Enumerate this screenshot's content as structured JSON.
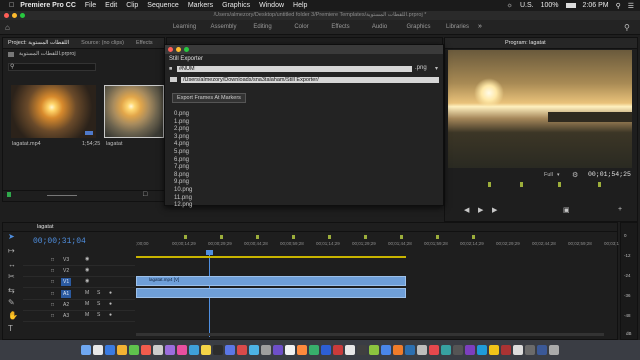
{
  "menubar": {
    "app": "Premiere Pro CC",
    "items": [
      "File",
      "Edit",
      "Clip",
      "Sequence",
      "Markers",
      "Graphics",
      "Window",
      "Help"
    ],
    "locale": "U.S.",
    "battery": "100%",
    "time": "2:06 PM"
  },
  "titlebar": {
    "path": "/Users/almezory/Desktop/untitled folder 3/Premiere Templates/اللقطات المستوية.prproj *"
  },
  "workspaces": [
    "Learning",
    "Assembly",
    "Editing",
    "Color",
    "Effects",
    "Audio",
    "Graphics",
    "Libraries"
  ],
  "project": {
    "tabs": [
      "Project: اللقطات المستوية",
      "Source: (no clips)",
      "Effects"
    ],
    "bin": "اللقطات المستوية.prproj",
    "items": [
      {
        "name": "lagatat.mp4",
        "duration": "1;54;25"
      },
      {
        "name": "lagatat",
        "duration": ""
      }
    ]
  },
  "program": {
    "tab": "Program: lagatat",
    "fit": "Full",
    "timecode": "00;01;54;25"
  },
  "dialog": {
    "title": "Still Exporter",
    "name_pattern": "#NUM",
    "format": ".png",
    "folder": "/Users/almezory/Downloads/sna3talaham/Still Exporter/",
    "export_button": "Export Frames At Markers",
    "files": [
      "0.png",
      "1.png",
      "2.png",
      "3.png",
      "4.png",
      "5.png",
      "6.png",
      "7.png",
      "8.png",
      "9.png",
      "10.png",
      "11.png",
      "12.png"
    ]
  },
  "timeline": {
    "sequence": "lagatat",
    "timecode": "00;00;31;04",
    "ruler": [
      ";00;00",
      "00;00;14;29",
      "00;00;29;29",
      "00;00;44;28",
      "00;00;59;28",
      "00;01;14;29",
      "00;01;29;29",
      "00;01;44;28",
      "00;01;59;28",
      "00;02;14;29",
      "00;02;29;29",
      "00;02;44;28",
      "00;02;59;28",
      "00;03;1"
    ],
    "tracks": [
      "V3",
      "V2",
      "V1",
      "A1",
      "A2",
      "A3"
    ],
    "track_buttons": [
      "M",
      "S"
    ],
    "clip_label": "lagatat.mp4 [V]"
  },
  "meter": {
    "scale": [
      "0",
      "-12",
      "-24",
      "-36",
      "-48"
    ],
    "unit": "dB"
  }
}
